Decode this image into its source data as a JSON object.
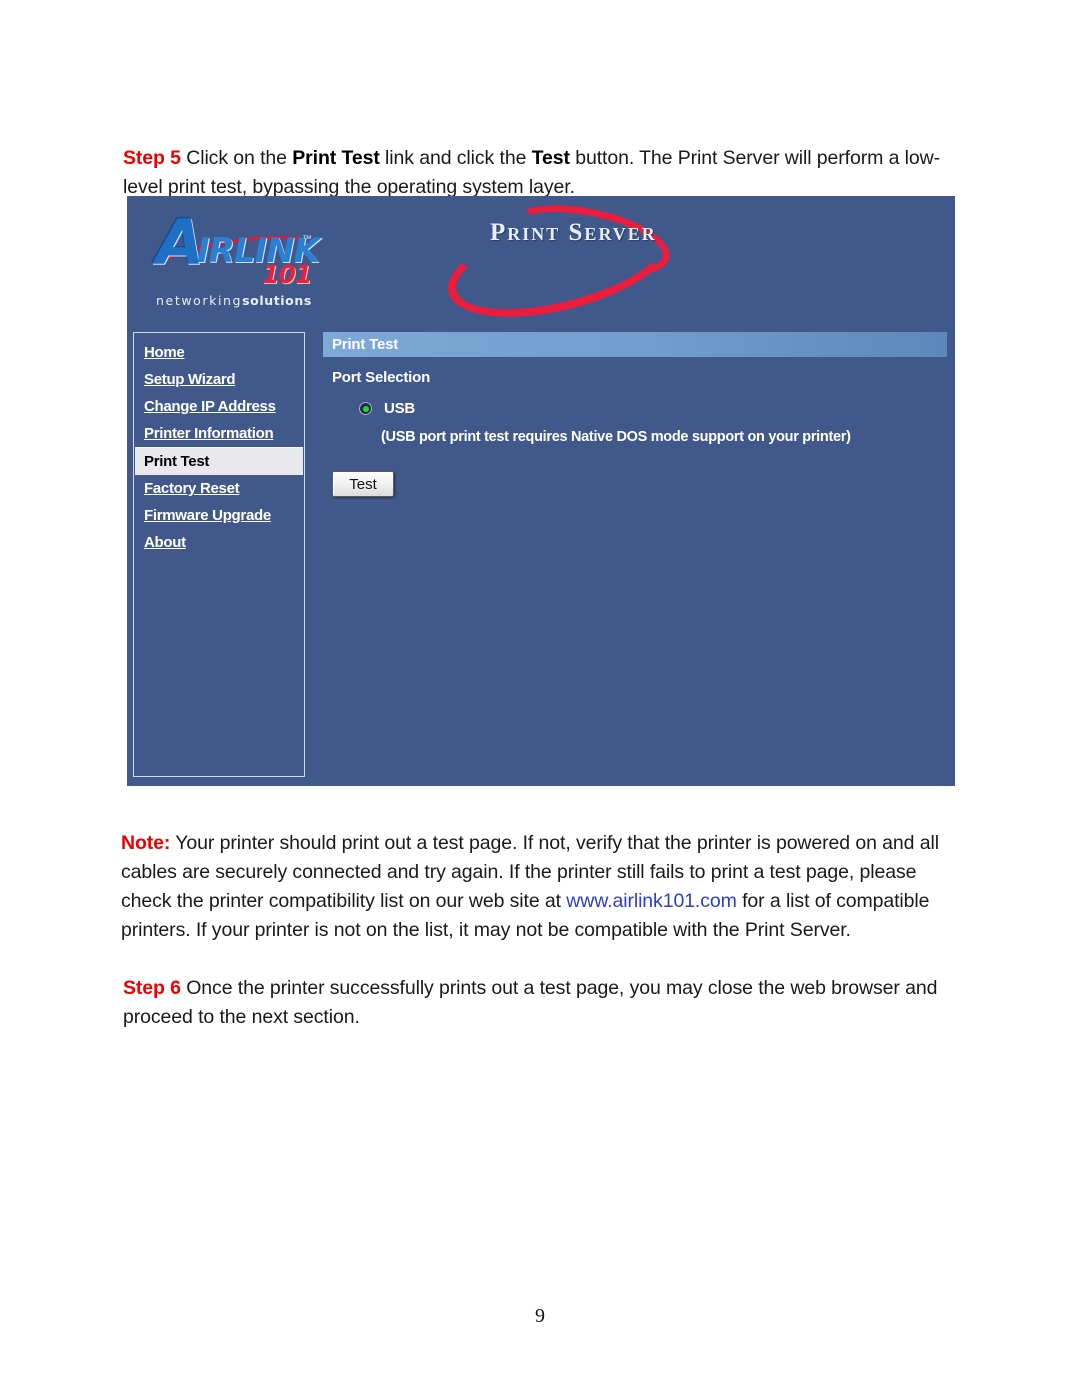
{
  "document": {
    "page_number": "9",
    "step5": {
      "label": "Step 5",
      "text_part1": " Click on the ",
      "bold1": "Print Test",
      "text_part2": " link and click the ",
      "bold2": "Test",
      "text_part3": " button. The Print Server will perform a low-level print test, bypassing the operating system layer."
    },
    "note": {
      "label": "Note:",
      "text_part1": " Your printer should print out a test page. If not, verify that the printer is powered on and all cables are securely connected and try again. If the printer still fails to print a test page, please check the printer compatibility list on our web site at ",
      "link": "www.airlink101.com",
      "text_part2": " for a list of compatible printers. If your printer is not on the list, it may not be compatible with the Print Server."
    },
    "step6": {
      "label": "Step 6",
      "text": " Once the printer successfully prints out a test page, you may close the web browser and proceed to the next section."
    }
  },
  "print_server_ui": {
    "colors": {
      "background": "#41598a",
      "title_bar_light": "#7ea9d6",
      "title_bar_dark": "#5c87ba",
      "accent_red": "#ec1c3c",
      "logo_blue": "#1f6fc4",
      "radio_green": "#2ad13d",
      "nav_active_bg": "#e9e9ed"
    },
    "logo": {
      "letter_a": "A",
      "wordmark_rest": "IRLINK",
      "trademark": "™",
      "number": "101",
      "tagline_light": "networking",
      "tagline_bold": "solutions"
    },
    "product_mark": "Print Server",
    "nav": {
      "items": [
        {
          "label": "Home",
          "active": false
        },
        {
          "label": "Setup Wizard",
          "active": false
        },
        {
          "label": "Change IP Address",
          "active": false
        },
        {
          "label": "Printer Information",
          "active": false
        },
        {
          "label": "Print Test",
          "active": true
        },
        {
          "label": "Factory Reset",
          "active": false
        },
        {
          "label": "Firmware Upgrade",
          "active": false
        },
        {
          "label": "About",
          "active": false
        }
      ]
    },
    "content": {
      "title": "Print Test",
      "port_selection_label": "Port Selection",
      "port_option": {
        "label": "USB",
        "selected": true
      },
      "hint": "(USB port print test requires Native DOS mode support on your printer)",
      "test_button_label": "Test"
    }
  }
}
